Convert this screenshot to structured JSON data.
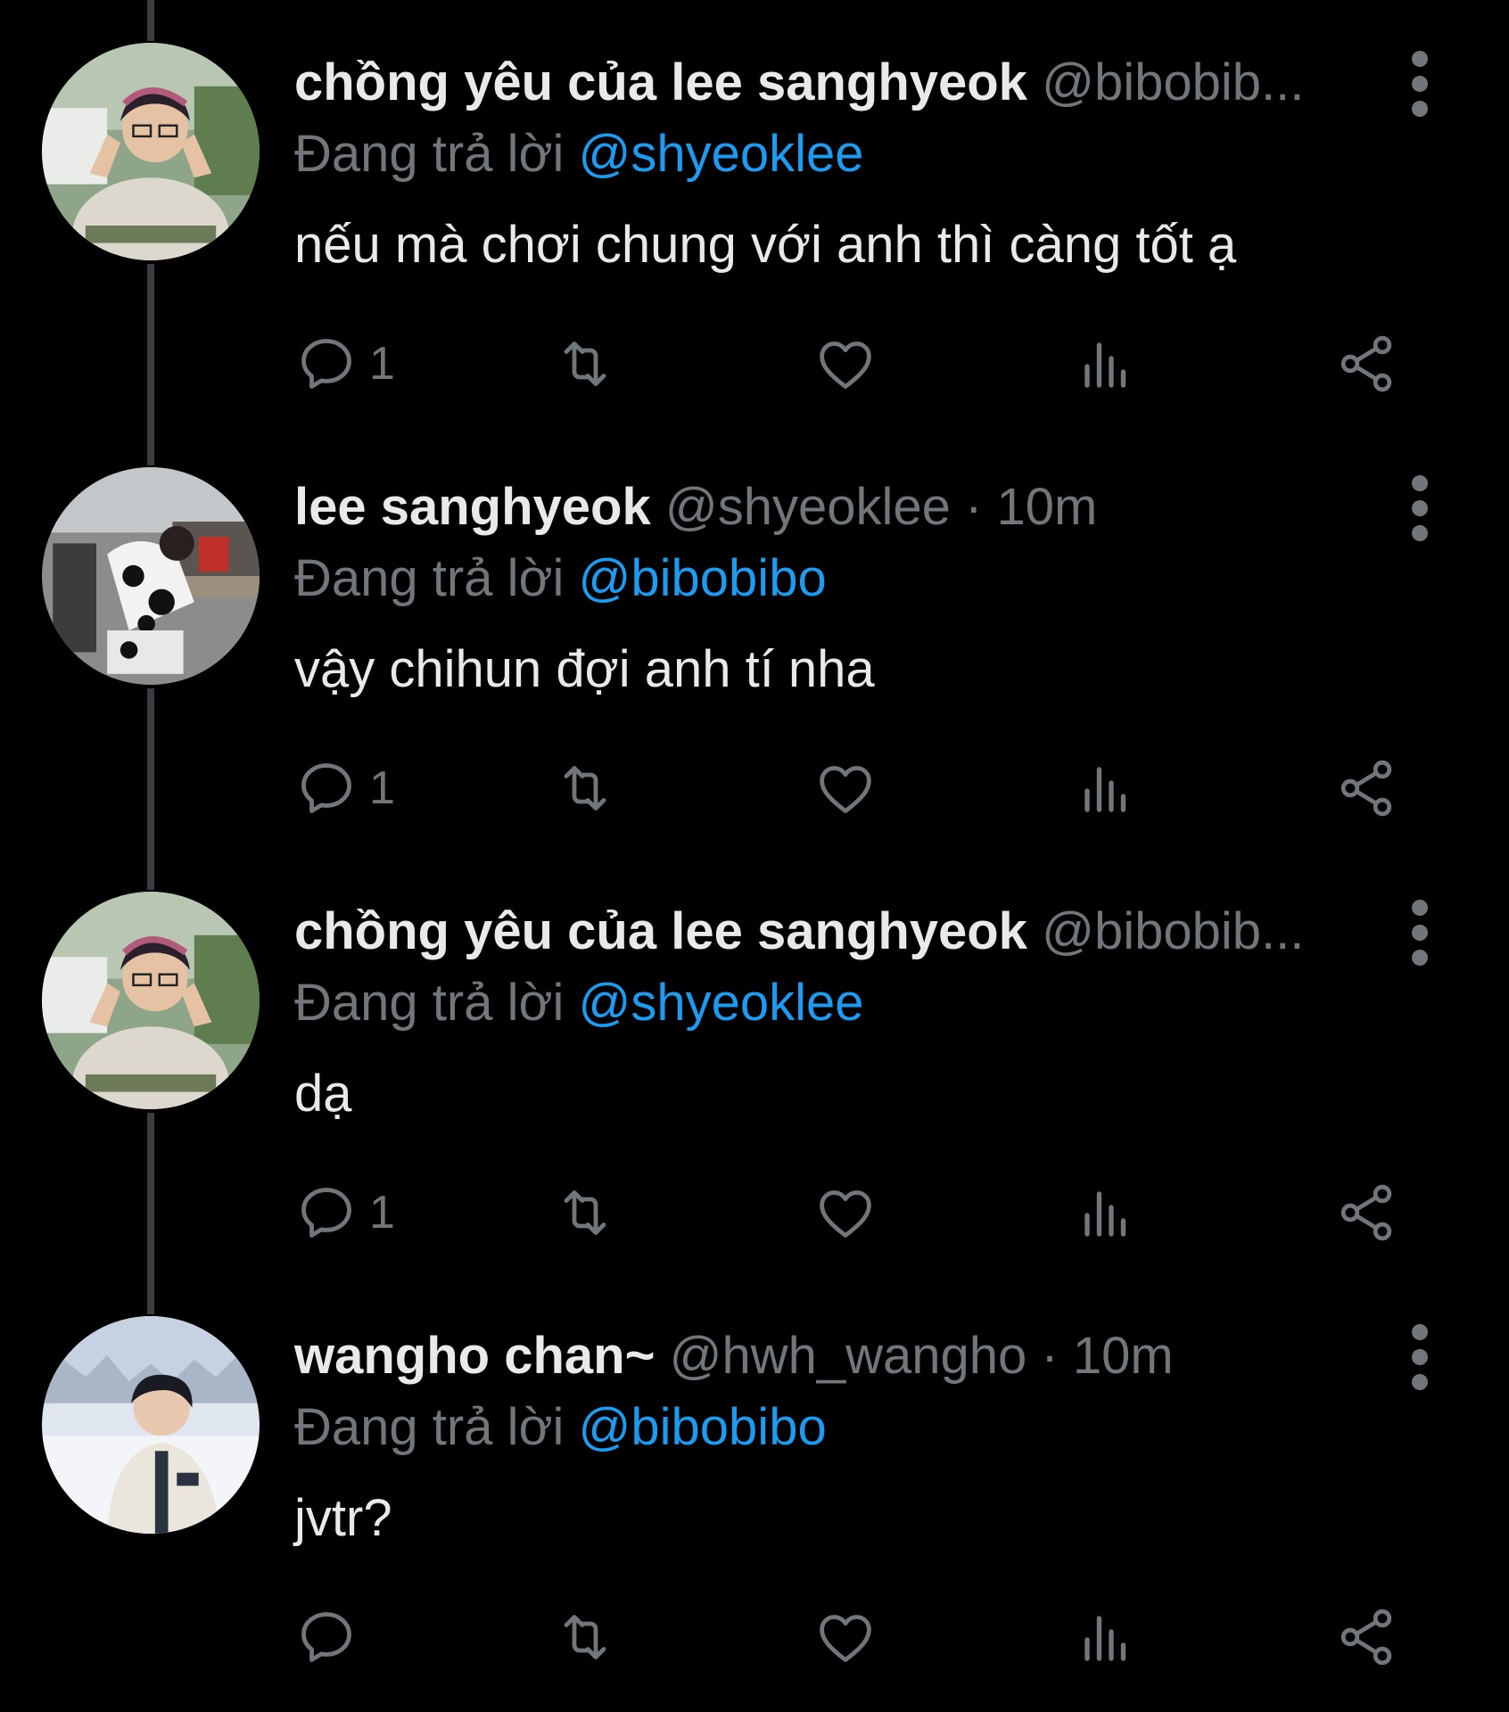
{
  "tweets": [
    {
      "display_name": "chồng yêu của lee sanghyeok",
      "handle": "@bibobib...",
      "time": "",
      "reply_prefix": "Đang trả lời",
      "reply_handle": "@shyeoklee",
      "text": "nếu mà chơi chung với anh thì càng tốt ạ",
      "reply_count": "1",
      "avatar": "profile-photo-person-glasses-outdoor"
    },
    {
      "display_name": "lee sanghyeok",
      "handle": "@shyeoklee",
      "time": "10m",
      "reply_prefix": "Đang trả lời",
      "reply_handle": "@bibobibo",
      "text": "vậy chihun đợi anh tí nha",
      "reply_count": "1",
      "avatar": "profile-photo-person-at-desk"
    },
    {
      "display_name": "chồng yêu của lee sanghyeok",
      "handle": "@bibobib...",
      "time": "",
      "reply_prefix": "Đang trả lời",
      "reply_handle": "@shyeoklee",
      "text": "dạ",
      "reply_count": "1",
      "avatar": "profile-photo-person-glasses-outdoor"
    },
    {
      "display_name": "wangho chan~",
      "handle": "@hwh_wangho",
      "time": "10m",
      "reply_prefix": "Đang trả lời",
      "reply_handle": "@bibobibo",
      "text": "jvtr?",
      "reply_count": "",
      "avatar": "profile-photo-person-snow"
    }
  ],
  "separator": "·",
  "icons": {
    "reply": "reply-icon",
    "retweet": "retweet-icon",
    "like": "heart-icon",
    "views": "views-chart-icon",
    "share": "share-icon",
    "more": "more-vertical-icon"
  },
  "colors": {
    "background": "#000000",
    "primary_text": "#e7e9ea",
    "secondary_text": "#71767b",
    "link": "#1d9bf0",
    "thread_line": "#3a3d40"
  }
}
